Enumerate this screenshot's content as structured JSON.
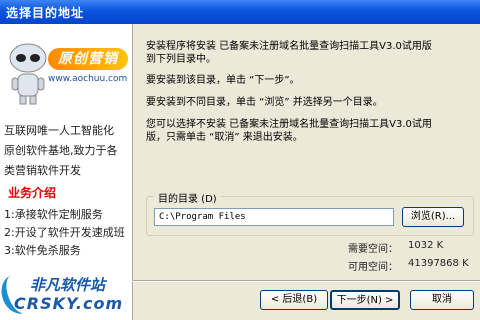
{
  "window": {
    "title": "选择目的地址"
  },
  "sidebar": {
    "brand_name": "原创营销",
    "brand_url": "www.aochuu.com",
    "lines": [
      "互联网唯一人工智能化",
      "原创软件基地,致力于各",
      "类营销软件开发"
    ],
    "section_title": "业务介绍",
    "services": [
      "1:承接软件定制服务",
      "2:开设了软件开发速成班",
      "3:软件免杀服务"
    ],
    "logo_cn": "非凡软件站",
    "logo_en": "CRSKY.com"
  },
  "content": {
    "line1": "安装程序将安装 已备案未注册域名批量查询扫描工具V3.0试用版",
    "line2": "到下列目录中。",
    "line3": "要安装到该目录，单击 “下一步”。",
    "line4": "要安装到不同目录，单击 “浏览” 并选择另一个目录。",
    "line5": "您可以选择不安装 已备案未注册域名批量查询扫描工具V3.0试用",
    "line6": "版，只需单击 “取消” 来退出安装。"
  },
  "destination": {
    "label": "目的目录 (D)",
    "path": "C:\\Program Files",
    "browse_label": "浏览(R)..."
  },
  "space": {
    "required_label": "需要空间：",
    "required_value": "1032 K",
    "available_label": "可用空间：",
    "available_value": "41397868 K"
  },
  "buttons": {
    "back": "< 后退(B)",
    "next": "下一步(N) >",
    "cancel": "取消"
  }
}
